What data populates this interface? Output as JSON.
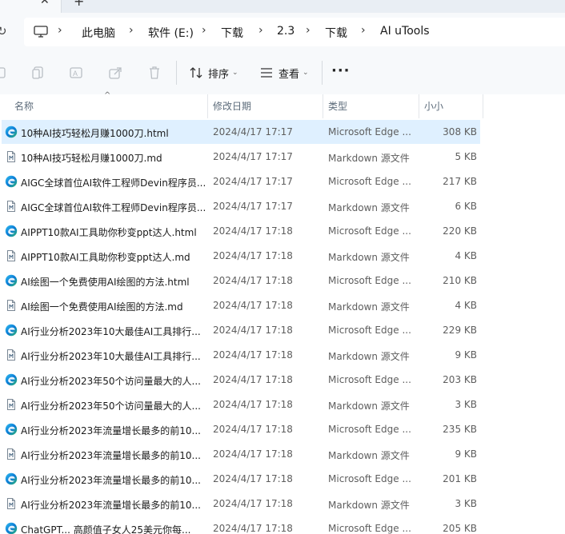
{
  "address": {
    "breadcrumbs": [
      "此电脑",
      "软件 (E:)",
      "下载",
      "2.3",
      "下载",
      "AI uTools"
    ]
  },
  "toolbar": {
    "sort_label": "排序",
    "view_label": "查看",
    "more_label": "···"
  },
  "columns": {
    "name": "名称",
    "date": "修改日期",
    "type": "类型",
    "size": "小小"
  },
  "files": [
    {
      "name": "10种AI技巧轻松月赚1000刀.html",
      "date": "2024/4/17 17:17",
      "type": "Microsoft Edge ...",
      "size": "308 KB",
      "icon": "edge-icon",
      "selected": true
    },
    {
      "name": "10种AI技巧轻松月赚1000刀.md",
      "date": "2024/4/17 17:17",
      "type": "Markdown 源文件",
      "size": "5 KB",
      "icon": "markdown-file-icon"
    },
    {
      "name": "AIGC全球首位AI软件工程师Devin程序员...",
      "date": "2024/4/17 17:17",
      "type": "Microsoft Edge ...",
      "size": "217 KB",
      "icon": "edge-icon"
    },
    {
      "name": "AIGC全球首位AI软件工程师Devin程序员...",
      "date": "2024/4/17 17:17",
      "type": "Markdown 源文件",
      "size": "6 KB",
      "icon": "markdown-file-icon"
    },
    {
      "name": "AIPPT10款AI工具助你秒变ppt达人.html",
      "date": "2024/4/17 17:18",
      "type": "Microsoft Edge ...",
      "size": "220 KB",
      "icon": "edge-icon"
    },
    {
      "name": "AIPPT10款AI工具助你秒变ppt达人.md",
      "date": "2024/4/17 17:18",
      "type": "Markdown 源文件",
      "size": "4 KB",
      "icon": "markdown-file-icon"
    },
    {
      "name": "AI绘图一个免费使用AI绘图的方法.html",
      "date": "2024/4/17 17:18",
      "type": "Microsoft Edge ...",
      "size": "210 KB",
      "icon": "edge-icon"
    },
    {
      "name": "AI绘图一个免费使用AI绘图的方法.md",
      "date": "2024/4/17 17:18",
      "type": "Markdown 源文件",
      "size": "4 KB",
      "icon": "markdown-file-icon"
    },
    {
      "name": "AI行业分析2023年10大最佳AI工具排行...",
      "date": "2024/4/17 17:18",
      "type": "Microsoft Edge ...",
      "size": "229 KB",
      "icon": "edge-icon"
    },
    {
      "name": "AI行业分析2023年10大最佳AI工具排行...",
      "date": "2024/4/17 17:18",
      "type": "Markdown 源文件",
      "size": "9 KB",
      "icon": "markdown-file-icon"
    },
    {
      "name": "AI行业分析2023年50个访问量最大的人...",
      "date": "2024/4/17 17:18",
      "type": "Microsoft Edge ...",
      "size": "203 KB",
      "icon": "edge-icon"
    },
    {
      "name": "AI行业分析2023年50个访问量最大的人...",
      "date": "2024/4/17 17:18",
      "type": "Markdown 源文件",
      "size": "3 KB",
      "icon": "markdown-file-icon"
    },
    {
      "name": "AI行业分析2023年流量增长最多的前10...",
      "date": "2024/4/17 17:18",
      "type": "Microsoft Edge ...",
      "size": "235 KB",
      "icon": "edge-icon"
    },
    {
      "name": "AI行业分析2023年流量增长最多的前10...",
      "date": "2024/4/17 17:18",
      "type": "Markdown 源文件",
      "size": "9 KB",
      "icon": "markdown-file-icon"
    },
    {
      "name": "AI行业分析2023年流量增长最多的前10...",
      "date": "2024/4/17 17:18",
      "type": "Microsoft Edge ...",
      "size": "201 KB",
      "icon": "edge-icon"
    },
    {
      "name": "AI行业分析2023年流量增长最多的前10...",
      "date": "2024/4/17 17:18",
      "type": "Markdown 源文件",
      "size": "3 KB",
      "icon": "markdown-file-icon"
    },
    {
      "name": "ChatGPT... 高颜值子女人25美元你每...",
      "date": "2024/4/17 17:18",
      "type": "Microsoft Edge ...",
      "size": "205 KB",
      "icon": "edge-icon"
    }
  ],
  "colors": {
    "selection": "#dff0ff",
    "accent": "#0067c0"
  }
}
